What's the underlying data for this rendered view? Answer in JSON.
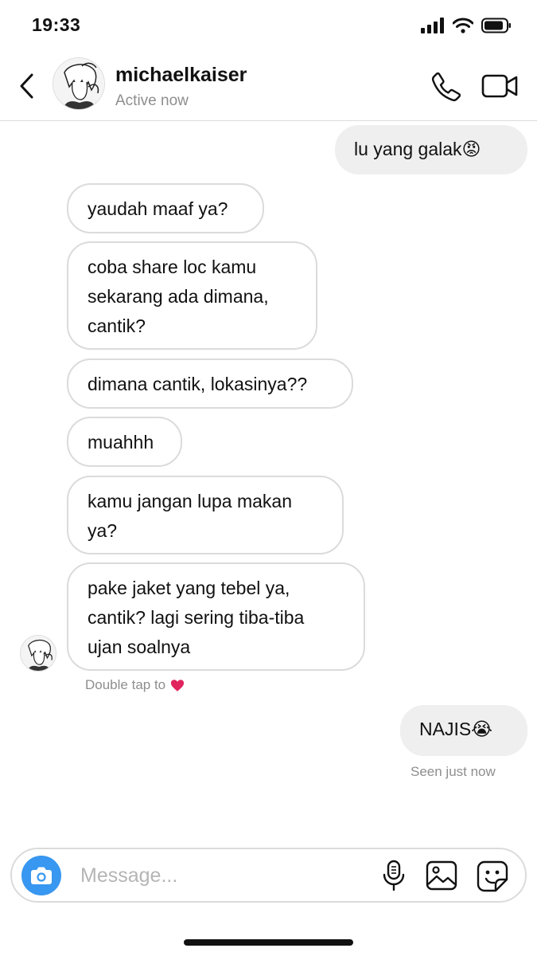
{
  "status_bar": {
    "time": "19:33"
  },
  "header": {
    "username": "michaelkaiser",
    "status": "Active now",
    "icons": [
      "back-icon",
      "avatar",
      "phone-icon",
      "video-camera-icon"
    ]
  },
  "messages": [
    {
      "direction": "out",
      "text": "lu yang galak😡"
    },
    {
      "direction": "in",
      "text": "yaudah maaf ya?"
    },
    {
      "direction": "in",
      "text": "coba share loc kamu\nsekarang ada dimana,\ncantik?"
    },
    {
      "direction": "in",
      "text": "dimana cantik, lokasinya??"
    },
    {
      "direction": "in",
      "text": "muahhh"
    },
    {
      "direction": "in",
      "text": "kamu jangan lupa makan\nya?"
    },
    {
      "direction": "in",
      "text": "pake jaket yang tebel ya,\ncantik? lagi sering tiba-tiba\nujan soalnya"
    },
    {
      "direction": "out",
      "text": "NAJIS😭"
    }
  ],
  "hints": {
    "double_tap": "Double tap to",
    "heart_icon": "heart-icon",
    "seen": "Seen just now"
  },
  "composer": {
    "placeholder": "Message...",
    "icons": [
      "camera-icon",
      "microphone-icon",
      "gallery-icon",
      "sticker-icon"
    ]
  },
  "colors": {
    "accent": "#3897f0",
    "outgoing_bubble": "#efefef",
    "incoming_border": "#dbdbdb",
    "secondary_text": "#8e8e8e",
    "heart": "#e0245e"
  }
}
